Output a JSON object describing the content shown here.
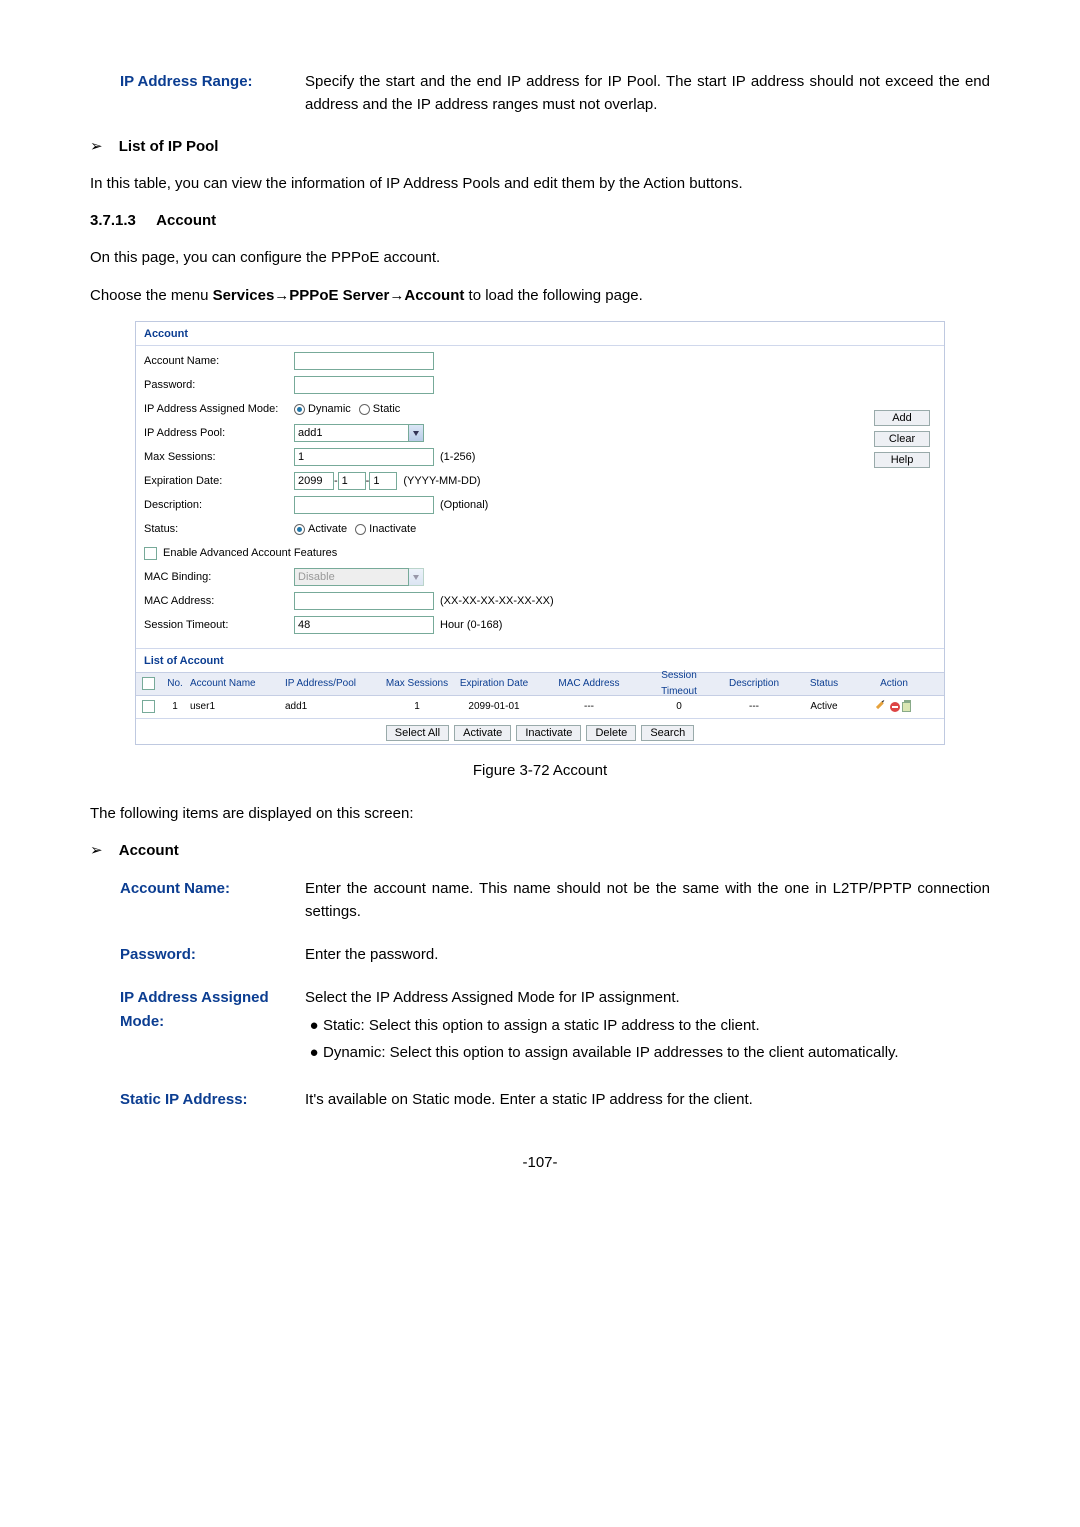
{
  "ip_range": {
    "label": "IP Address Range:",
    "value": "Specify the start and the end IP address for IP Pool. The start IP address should not exceed the end address and the IP address ranges must not overlap."
  },
  "list_of_ip_pool": {
    "heading": "List of IP Pool",
    "text": "In this table, you can view the information of IP Address Pools and edit them by the Action buttons."
  },
  "section": {
    "num": "3.7.1.3",
    "title": "Account",
    "intro": "On this page, you can configure the PPPoE account.",
    "menu_prefix": "Choose the menu ",
    "menu_bold": "Services→PPPoE Server→Account",
    "menu_suffix": " to load the following page."
  },
  "figure": {
    "title": "Account",
    "rows": {
      "account_name": "Account Name:",
      "password": "Password:",
      "ip_mode": {
        "label": "IP Address Assigned Mode:",
        "opt1": "Dynamic",
        "opt2": "Static"
      },
      "ip_pool": {
        "label": "IP Address Pool:",
        "value": "add1"
      },
      "max_sessions": {
        "label": "Max Sessions:",
        "value": "1",
        "hint": "(1-256)"
      },
      "exp_date": {
        "label": "Expiration Date:",
        "y": "2099",
        "m": "1",
        "d": "1",
        "hint": "(YYYY-MM-DD)"
      },
      "description": {
        "label": "Description:",
        "hint": "(Optional)"
      },
      "status": {
        "label": "Status:",
        "opt1": "Activate",
        "opt2": "Inactivate"
      },
      "enable_adv": "Enable Advanced Account Features",
      "mac_binding": {
        "label": "MAC Binding:",
        "value": "Disable"
      },
      "mac_address": {
        "label": "MAC Address:",
        "hint": "(XX-XX-XX-XX-XX-XX)"
      },
      "session_timeout": {
        "label": "Session Timeout:",
        "value": "48",
        "hint": "Hour (0-168)"
      }
    },
    "buttons": {
      "add": "Add",
      "clear": "Clear",
      "help": "Help"
    },
    "list_title": "List of Account",
    "headers": {
      "no": "No.",
      "acct": "Account Name",
      "pool": "IP Address/Pool",
      "max": "Max Sessions",
      "exp": "Expiration Date",
      "mac": "MAC Address",
      "sess": "Session Timeout",
      "desc": "Description",
      "status": "Status",
      "action": "Action"
    },
    "row1": {
      "no": "1",
      "acct": "user1",
      "pool": "add1",
      "max": "1",
      "exp": "2099-01-01",
      "mac": "---",
      "sess": "0",
      "desc": "---",
      "status": "Active"
    },
    "bottom_btns": {
      "sel": "Select All",
      "act": "Activate",
      "inact": "Inactivate",
      "del": "Delete",
      "search": "Search"
    },
    "caption": "Figure 3-72 Account"
  },
  "displayed_on_screen": "The following items are displayed on this screen:",
  "account_section_heading": "Account",
  "defs": {
    "account_name": {
      "label": "Account Name:",
      "text": "Enter the account name. This name should not be the same with the one in L2TP/PPTP connection settings."
    },
    "password": {
      "label": "Password:",
      "text": "Enter the password."
    },
    "ip_mode": {
      "label1": "IP Address Assigned",
      "label2": "Mode:",
      "lead": "Select the IP Address Assigned Mode for IP assignment.",
      "b1": "Static: Select this option to assign a static IP address to the client.",
      "b2": "Dynamic: Select this option to assign available IP addresses to the client automatically."
    },
    "static_ip": {
      "label": "Static IP Address:",
      "text": "It's available on Static mode. Enter a static IP address for the client."
    }
  },
  "page_number": "-107-"
}
